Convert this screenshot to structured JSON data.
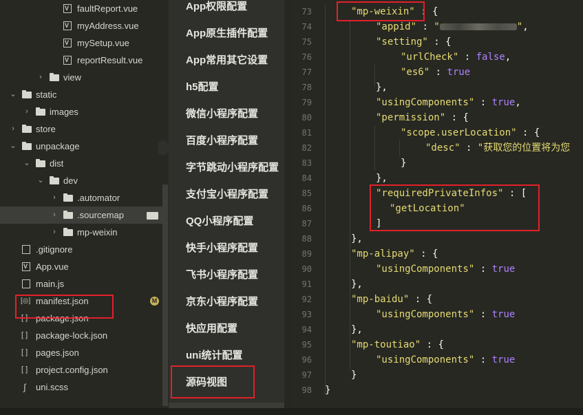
{
  "explorer": {
    "items": [
      {
        "label": "faultReport.vue",
        "type": "vue",
        "depth": 3,
        "chev": ""
      },
      {
        "label": "myAddress.vue",
        "type": "vue",
        "depth": 3,
        "chev": ""
      },
      {
        "label": "mySetup.vue",
        "type": "vue",
        "depth": 3,
        "chev": ""
      },
      {
        "label": "reportResult.vue",
        "type": "vue",
        "depth": 3,
        "chev": ""
      },
      {
        "label": "view",
        "type": "folder",
        "depth": 2,
        "chev": ">"
      },
      {
        "label": "static",
        "type": "folder",
        "depth": 0,
        "chev": "v"
      },
      {
        "label": "images",
        "type": "folder",
        "depth": 1,
        "chev": ">"
      },
      {
        "label": "store",
        "type": "folder",
        "depth": 0,
        "chev": ">"
      },
      {
        "label": "unpackage",
        "type": "folder",
        "depth": 0,
        "chev": "v"
      },
      {
        "label": "dist",
        "type": "folder",
        "depth": 1,
        "chev": "v"
      },
      {
        "label": "dev",
        "type": "folder",
        "depth": 2,
        "chev": "v"
      },
      {
        "label": ".automator",
        "type": "folder",
        "depth": 3,
        "chev": ">"
      },
      {
        "label": ".sourcemap",
        "type": "folder",
        "depth": 3,
        "chev": ">",
        "selected": true
      },
      {
        "label": "mp-weixin",
        "type": "folder",
        "depth": 3,
        "chev": ">"
      },
      {
        "label": ".gitignore",
        "type": "doc",
        "depth": 0,
        "chev": ""
      },
      {
        "label": "App.vue",
        "type": "vue",
        "depth": 0,
        "chev": ""
      },
      {
        "label": "main.js",
        "type": "doc",
        "depth": 0,
        "chev": ""
      },
      {
        "label": "manifest.json",
        "type": "jsonbr",
        "depth": 0,
        "chev": "",
        "badge": "M"
      },
      {
        "label": "package.json",
        "type": "bracket",
        "depth": 0,
        "chev": ""
      },
      {
        "label": "package-lock.json",
        "type": "bracket",
        "depth": 0,
        "chev": ""
      },
      {
        "label": "pages.json",
        "type": "bracket",
        "depth": 0,
        "chev": ""
      },
      {
        "label": "project.config.json",
        "type": "bracket",
        "depth": 0,
        "chev": ""
      },
      {
        "label": "uni.scss",
        "type": "scss",
        "depth": 0,
        "chev": ""
      }
    ]
  },
  "config_nav": {
    "items": [
      "App权限配置",
      "App原生插件配置",
      "App常用其它设置",
      "h5配置",
      "微信小程序配置",
      "百度小程序配置",
      "字节跳动小程序配置",
      "支付宝小程序配置",
      "QQ小程序配置",
      "快手小程序配置",
      "飞书小程序配置",
      "京东小程序配置",
      "快应用配置",
      "uni统计配置",
      "源码视图"
    ]
  },
  "editor": {
    "lines": [
      {
        "n": "73",
        "indent": 1,
        "html": "<span class=\"s-key\">\"mp-weixin\"</span><span class=\"pn\"> : {</span>"
      },
      {
        "n": "74",
        "indent": 2,
        "html": "<span class=\"s-key\">\"appid\"</span><span class=\"pn\"> : </span><span class=\"s-key2\">\"<span class=\"blur\"></span>\"</span><span class=\"pn\">,</span>"
      },
      {
        "n": "75",
        "indent": 2,
        "html": "<span class=\"s-key\">\"setting\"</span><span class=\"pn\"> : {</span>"
      },
      {
        "n": "76",
        "indent": 3,
        "html": "<span class=\"s-key\">\"urlCheck\"</span><span class=\"pn\"> : </span><span class=\"kw\">false</span><span class=\"pn\">,</span>"
      },
      {
        "n": "77",
        "indent": 3,
        "html": "<span class=\"s-key\">\"es6\"</span><span class=\"pn\"> : </span><span class=\"kw\">true</span>"
      },
      {
        "n": "78",
        "indent": 2,
        "html": "<span class=\"pn\">},</span>"
      },
      {
        "n": "79",
        "indent": 2,
        "html": "<span class=\"s-key\">\"usingComponents\"</span><span class=\"pn\"> : </span><span class=\"kw\">true</span><span class=\"pn\">,</span>"
      },
      {
        "n": "80",
        "indent": 2,
        "html": "<span class=\"s-key\">\"permission\"</span><span class=\"pn\"> : {</span>"
      },
      {
        "n": "81",
        "indent": 3,
        "html": "<span class=\"s-key\">\"scope.userLocation\"</span><span class=\"pn\"> : {</span>"
      },
      {
        "n": "82",
        "indent": 4,
        "html": "<span class=\"s-key\">\"desc\"</span><span class=\"pn\"> : </span><span class=\"s-key2\">\"获取您的位置将为您</span>"
      },
      {
        "n": "83",
        "indent": 3,
        "html": "<span class=\"pn\">}</span>"
      },
      {
        "n": "84",
        "indent": 2,
        "html": "<span class=\"pn\">},</span>"
      },
      {
        "n": "85",
        "indent": 2,
        "html": "<span class=\"s-key\">\"requiredPrivateInfos\"</span><span class=\"pn\"> : [</span>"
      },
      {
        "n": "86",
        "indent": 2,
        "extra": 20,
        "html": "<span class=\"s-key2\">\"getLocation\"</span>"
      },
      {
        "n": "87",
        "indent": 2,
        "html": "<span class=\"pn\">]</span>"
      },
      {
        "n": "88",
        "indent": 1,
        "html": "<span class=\"pn\">},</span>"
      },
      {
        "n": "89",
        "indent": 1,
        "html": "<span class=\"s-key\">\"mp-alipay\"</span><span class=\"pn\"> : {</span>"
      },
      {
        "n": "90",
        "indent": 2,
        "html": "<span class=\"s-key\">\"usingComponents\"</span><span class=\"pn\"> : </span><span class=\"kw\">true</span>"
      },
      {
        "n": "91",
        "indent": 1,
        "html": "<span class=\"pn\">},</span>"
      },
      {
        "n": "92",
        "indent": 1,
        "html": "<span class=\"s-key\">\"mp-baidu\"</span><span class=\"pn\"> : {</span>"
      },
      {
        "n": "93",
        "indent": 2,
        "html": "<span class=\"s-key\">\"usingComponents\"</span><span class=\"pn\"> : </span><span class=\"kw\">true</span>"
      },
      {
        "n": "94",
        "indent": 1,
        "html": "<span class=\"pn\">},</span>"
      },
      {
        "n": "95",
        "indent": 1,
        "html": "<span class=\"s-key\">\"mp-toutiao\"</span><span class=\"pn\"> : {</span>"
      },
      {
        "n": "96",
        "indent": 2,
        "html": "<span class=\"s-key\">\"usingComponents\"</span><span class=\"pn\"> : </span><span class=\"kw\">true</span>"
      },
      {
        "n": "97",
        "indent": 1,
        "html": "<span class=\"pn\">}</span>"
      },
      {
        "n": "98",
        "indent": 0,
        "html": "<span class=\"pn\">}</span>"
      }
    ]
  },
  "colors": {
    "background": "#272822",
    "highlight_box": "#e3202a",
    "string": "#e6db74",
    "keyword": "#ae81ff"
  }
}
